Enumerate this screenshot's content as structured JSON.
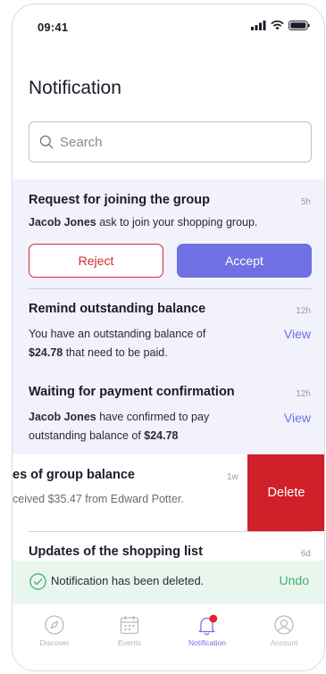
{
  "status_bar": {
    "time": "09:41"
  },
  "page": {
    "title": "Notification"
  },
  "search": {
    "placeholder": "Search"
  },
  "notifications": [
    {
      "title": "Request for joining the group",
      "time": "5h",
      "body_name": "Jacob Jones",
      "body_rest": " ask to join your shopping group.",
      "reject_label": "Reject",
      "accept_label": "Accept"
    },
    {
      "title": "Remind outstanding balance",
      "time": "12h",
      "body_line1": "You have an outstanding balance of",
      "body_amount": "$24.78",
      "body_rest": " that need to be paid.",
      "action_label": "View"
    },
    {
      "title": "Waiting for payment confirmation",
      "time": "12h",
      "body_name": "Jacob Jones",
      "body_rest1": " have confirmed to pay",
      "body_line2": "outstanding balance of ",
      "body_amount": "$24.78",
      "action_label": "View"
    },
    {
      "title": "es of group balance",
      "time": "1w",
      "body": "ceived $35.47 from Edward Potter.",
      "delete_label": "Delete"
    },
    {
      "title": "Updates of the shopping list",
      "time": "6d"
    }
  ],
  "toast": {
    "message": "Notification has been deleted.",
    "undo_label": "Undo"
  },
  "tabbar": {
    "items": [
      {
        "label": "Discover",
        "icon": "compass-icon",
        "active": false
      },
      {
        "label": "Events",
        "icon": "calendar-icon",
        "active": false
      },
      {
        "label": "Notification",
        "icon": "bell-icon",
        "active": true
      },
      {
        "label": "Account",
        "icon": "user-icon",
        "active": false
      }
    ]
  },
  "colors": {
    "accent": "#6f70e4",
    "danger": "#d0202a",
    "success": "#3fae6d",
    "highlight_bg": "#f1f2fb",
    "toast_bg": "#e9f6ee"
  }
}
